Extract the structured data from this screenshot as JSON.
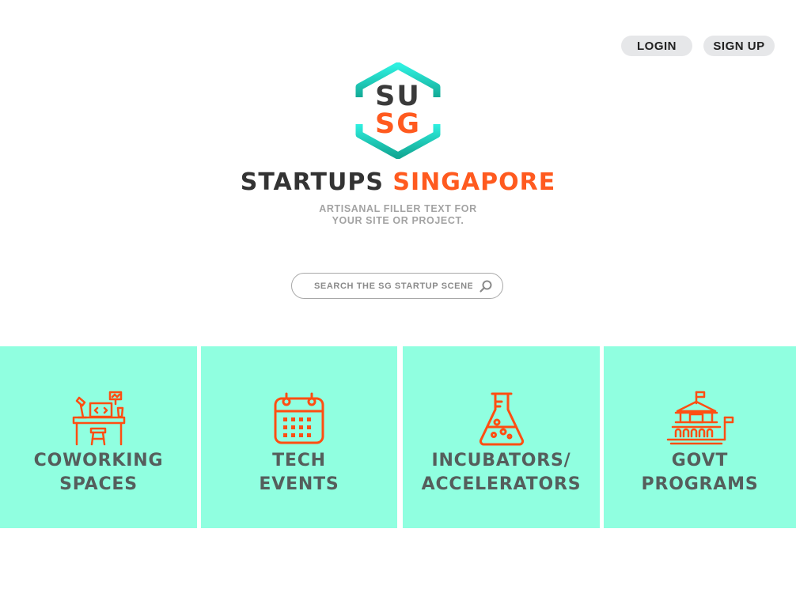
{
  "header": {
    "login_label": "LOGIN",
    "signup_label": "SIGN UP"
  },
  "logo": {
    "line1": "SU",
    "line2": "SG"
  },
  "brand": {
    "title_part1": "STARTUPS",
    "title_part2": "SINGAPORE",
    "tagline_line1": "ARTISANAL FILLER TEXT FOR",
    "tagline_line2": "YOUR SITE OR PROJECT."
  },
  "search": {
    "placeholder": "SEARCH THE SG STARTUP SCENE"
  },
  "categories": [
    {
      "line1": "COWORKING",
      "line2": "SPACES",
      "icon": "desk-icon"
    },
    {
      "line1": "TECH",
      "line2": "EVENTS",
      "icon": "calendar-icon"
    },
    {
      "line1": "INCUBATORS/",
      "line2": "ACCELERATORS",
      "icon": "flask-icon"
    },
    {
      "line1": "GOVT",
      "line2": "PROGRAMS",
      "icon": "government-building-icon"
    }
  ],
  "colors": {
    "accent": "#ff5a1f",
    "tile_bg": "#90ffe0",
    "hex_teal_top": "#27e3d8",
    "hex_teal_bottom": "#18b7a4",
    "dark_text": "#333333"
  }
}
